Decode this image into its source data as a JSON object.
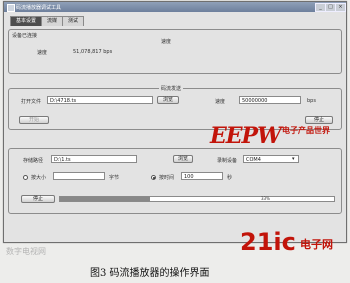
{
  "window": {
    "title": "码流播放器调试工具",
    "min": "_",
    "max": "□",
    "close": "×"
  },
  "tabs": [
    {
      "label": "基本设置"
    },
    {
      "label": "流媒"
    },
    {
      "label": "测试"
    }
  ],
  "status_group": {
    "legend": "设备已连接",
    "center_label": "速度",
    "rate_label": "速度",
    "rate_value": "51,078,817 bps"
  },
  "send_group": {
    "legend": "码流发送",
    "open_file_label": "打开文件",
    "file_value": "D:\\4718.ts",
    "browse_label": "浏览",
    "speed_label": "速度",
    "speed_value": "50000000",
    "unit": "bps",
    "open_button": "开始",
    "stop_button": "停止"
  },
  "recv_group": {
    "save_path_label": "存储路径",
    "save_path_value": "D:\\1.ts",
    "browse_label": "浏览",
    "device_label": "录制设备",
    "device_value": "COM4",
    "opt_bytes_label": "按大小",
    "bytes_unit": "字节",
    "opt_time_label": "按时间",
    "time_value": "100",
    "time_unit": "秒",
    "stop_button": "停止",
    "progress_label": "33%"
  },
  "bottom_label": "",
  "watermarks": {
    "eepw": "EEPW",
    "eepw_sub": "电子产品世界",
    "site": "21ic",
    "site_sub": "电子网",
    "blur_text": "数字电视网"
  },
  "caption": "图3  码流播放器的操作界面",
  "progress": {
    "fraction": 0.33
  }
}
